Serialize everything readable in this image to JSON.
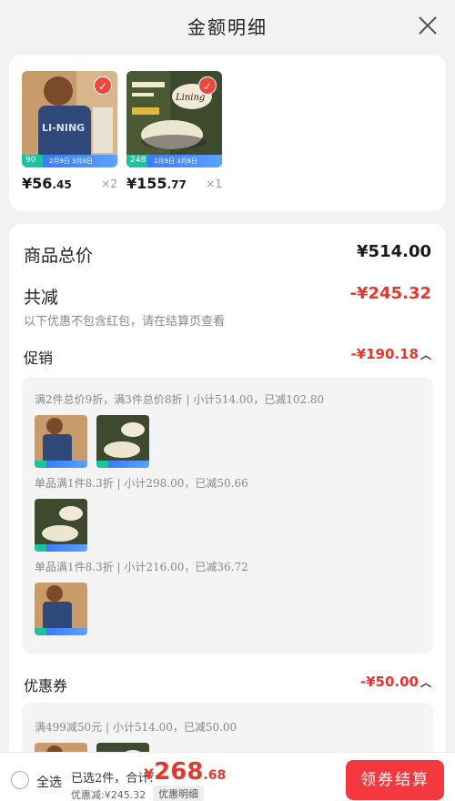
{
  "header": {
    "title": "金额明细",
    "close_icon": "close-icon"
  },
  "goods": [
    {
      "tag_num": "90",
      "tag_date": "2月9日 3月8日",
      "price_int": "¥56",
      "price_dec": ".45",
      "qty": "×2"
    },
    {
      "tag_num": "248",
      "tag_date": "2月9日 3月8日",
      "price_int": "¥155",
      "price_dec": ".77",
      "qty": "×1"
    }
  ],
  "summary": {
    "total_label": "商品总价",
    "total_value": "¥514.00",
    "discount_label": "共减",
    "discount_value": "-¥245.32",
    "note": "以下优惠不包含红包，请在结算页查看"
  },
  "promo": {
    "label": "促销",
    "value": "-¥190.18",
    "rules": [
      "满2件总价9折，满3件总价8折 | 小计514.00，已减102.80",
      "单品满1件8.3折 | 小计298.00，已减50.66",
      "单品满1件8.3折 | 小计216.00，已减36.72"
    ]
  },
  "coupon": {
    "label": "优惠券",
    "value": "-¥50.00",
    "rule": "满499减50元 | 小计514.00，已减50.00"
  },
  "bottom": {
    "select_all": "全选",
    "selected_info": "已选2件，合计:",
    "total_sym": "¥",
    "total_int": "268",
    "total_dec": ".68",
    "discount_text": "优惠减:¥245.32",
    "detail_btn": "优惠明细",
    "checkout": "领券结算"
  },
  "colors": {
    "accent_red": "#e8352e",
    "checkout_bg": "#f5383e",
    "tag_green": "#1fc29e",
    "tag_blue": "#3a7bff"
  }
}
